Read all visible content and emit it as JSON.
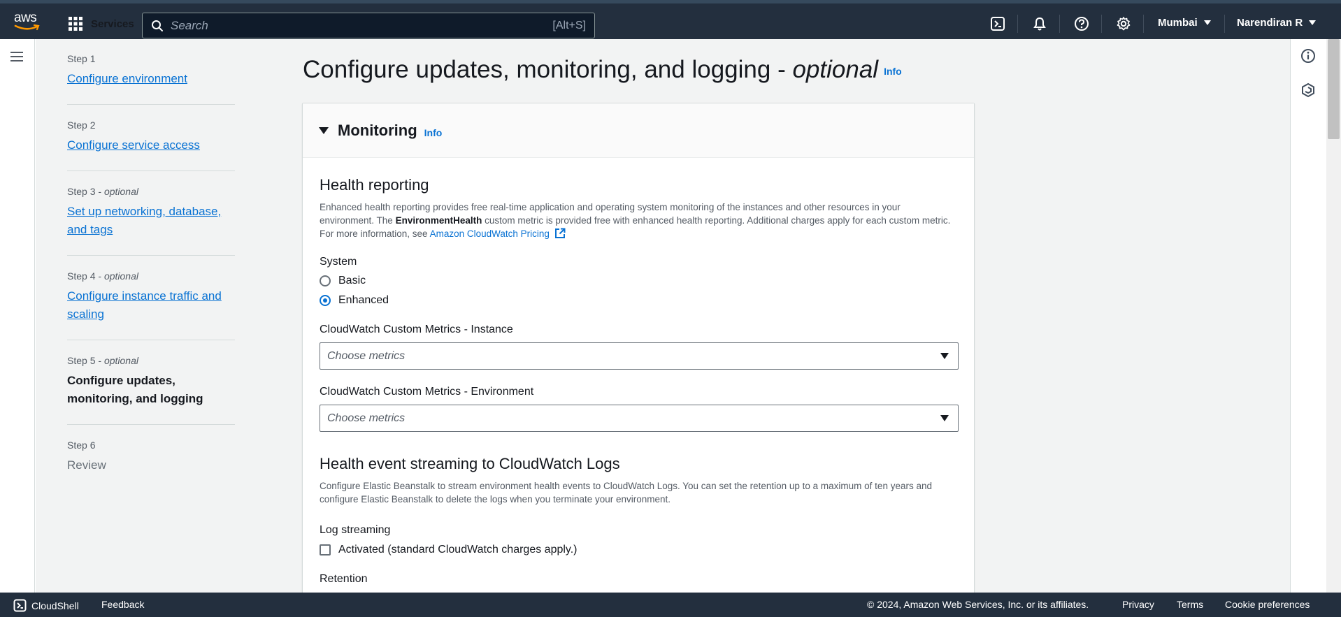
{
  "topbar": {
    "logo_text": "aws",
    "services_label": "Services",
    "search_placeholder": "Search",
    "search_shortcut": "[Alt+S]",
    "region": "Mumbai",
    "user": "Narendiran R"
  },
  "steps": [
    {
      "num": "Step 1",
      "optional": "",
      "label": "Configure environment",
      "state": "link"
    },
    {
      "num": "Step 2",
      "optional": "",
      "label": "Configure service access",
      "state": "link"
    },
    {
      "num": "Step 3",
      "optional": "optional",
      "label": "Set up networking, database, and tags",
      "state": "link"
    },
    {
      "num": "Step 4",
      "optional": "optional",
      "label": "Configure instance traffic and scaling",
      "state": "link"
    },
    {
      "num": "Step 5",
      "optional": "optional",
      "label": "Configure updates, monitoring, and logging",
      "state": "current"
    },
    {
      "num": "Step 6",
      "optional": "",
      "label": "Review",
      "state": "disabled"
    }
  ],
  "page": {
    "title": "Configure updates, monitoring, and logging - ",
    "title_italic": "optional",
    "info": "Info"
  },
  "monitoring": {
    "header": "Monitoring",
    "info": "Info",
    "health": {
      "title": "Health reporting",
      "desc_1": "Enhanced health reporting provides free real-time application and operating system monitoring of the instances and other resources in your environment. The ",
      "desc_bold": "EnvironmentHealth",
      "desc_2": " custom metric is provided free with enhanced health reporting. Additional charges apply for each custom metric. For more information, see ",
      "desc_link": "Amazon CloudWatch Pricing"
    },
    "system": {
      "label": "System",
      "options": [
        "Basic",
        "Enhanced"
      ],
      "selected": "Enhanced"
    },
    "cw_instance": {
      "label": "CloudWatch Custom Metrics - Instance",
      "placeholder": "Choose metrics"
    },
    "cw_environment": {
      "label": "CloudWatch Custom Metrics - Environment",
      "placeholder": "Choose metrics"
    },
    "streaming": {
      "title": "Health event streaming to CloudWatch Logs",
      "desc": "Configure Elastic Beanstalk to stream environment health events to CloudWatch Logs. You can set the retention up to a maximum of ten years and configure Elastic Beanstalk to delete the logs when you terminate your environment.",
      "log_label": "Log streaming",
      "checkbox_label": "Activated (standard CloudWatch charges apply.)",
      "checked": false,
      "retention_label": "Retention"
    }
  },
  "footer": {
    "cloudshell": "CloudShell",
    "feedback": "Feedback",
    "copyright": "© 2024, Amazon Web Services, Inc. or its affiliates.",
    "privacy": "Privacy",
    "terms": "Terms",
    "cookies": "Cookie preferences"
  },
  "colors": {
    "nav_bg": "#232f3e",
    "link": "#0972d3",
    "page_bg": "#f2f3f3"
  }
}
